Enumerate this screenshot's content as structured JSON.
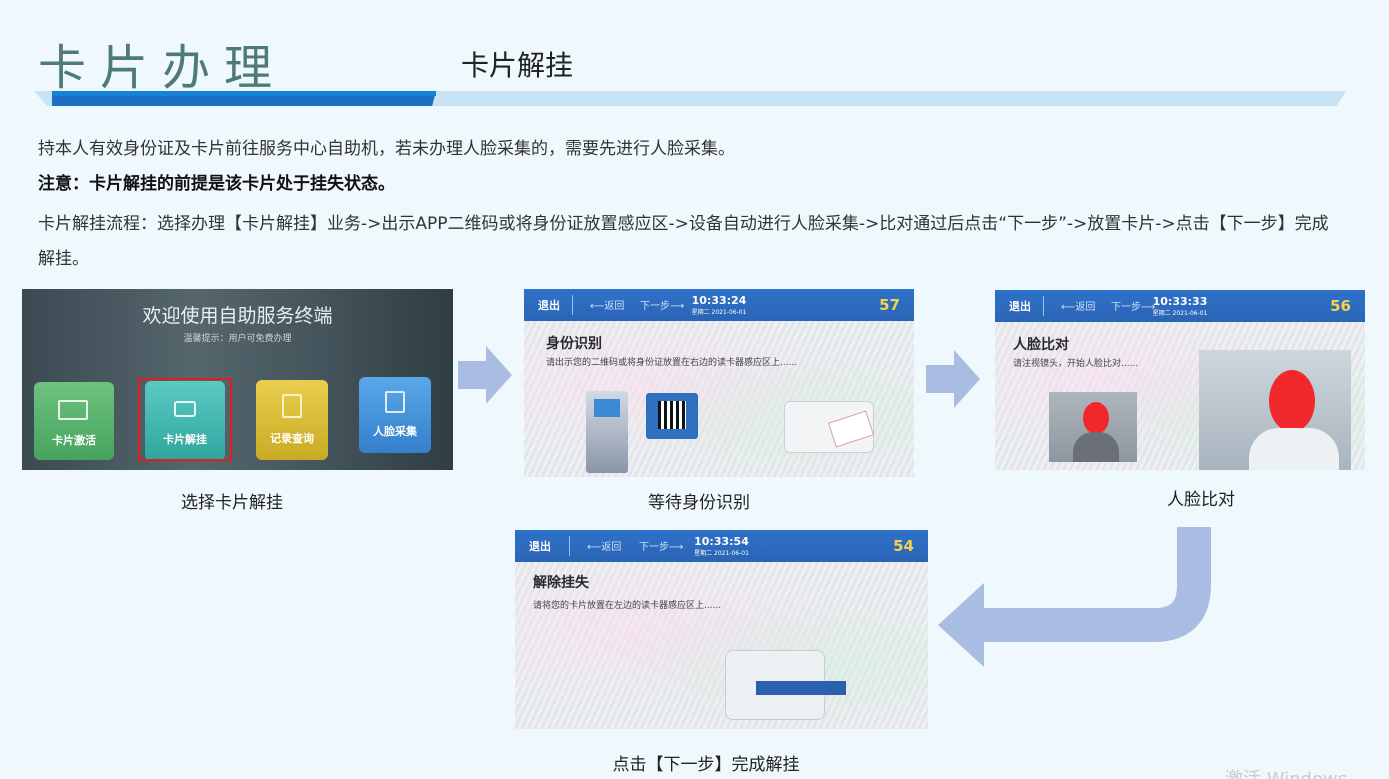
{
  "header": {
    "main_title": "卡片办理",
    "sub_title": "卡片解挂"
  },
  "content": {
    "line1": "持本人有效身份证及卡片前往服务中心自助机，若未办理人脸采集的，需要先进行人脸采集。",
    "line2": "注意：卡片解挂的前提是该卡片处于挂失状态。",
    "line3": "卡片解挂流程：选择办理【卡片解挂】业务->出示APP二维码或将身份证放置感应区->设备自动进行人脸采集->比对通过后点击“下一步”->放置卡片->点击【下一步】完成解挂。"
  },
  "steps": [
    {
      "caption": "选择卡片解挂",
      "welcome": "欢迎使用自助服务终端",
      "tip": "温馨提示：用户可免费办理",
      "tiles": [
        "卡片激活",
        "卡片解挂",
        "记录查询",
        "人脸采集"
      ]
    },
    {
      "caption": "等待身份识别",
      "bar": {
        "exit": "退出",
        "back": "返回",
        "next": "下一步",
        "time": "10:33:24",
        "date": "星期二 2021-06-01",
        "count": "57"
      },
      "heading": "身份识别",
      "hint": "请出示您的二维码或将身份证放置在右边的读卡器感应区上......"
    },
    {
      "caption": "人脸比对",
      "bar": {
        "exit": "退出",
        "back": "返回",
        "next": "下一步",
        "time": "10:33:33",
        "date": "星期二 2021-06-01",
        "count": "56"
      },
      "heading": "人脸比对",
      "hint": "请注视镜头，开始人脸比对......"
    },
    {
      "caption": "点击【下一步】完成解挂",
      "bar": {
        "exit": "退出",
        "back": "返回",
        "next": "下一步",
        "time": "10:33:54",
        "date": "星期二 2021-06-01",
        "count": "54"
      },
      "heading": "解除挂失",
      "hint": "请将您的卡片放置在左边的读卡器感应区上......"
    }
  ],
  "colors": {
    "accent": "#1e6fc4",
    "band": "#c8e2f6",
    "arrow": "#a9bde2",
    "title": "#4f7a78"
  },
  "watermark": "激活 Windows"
}
